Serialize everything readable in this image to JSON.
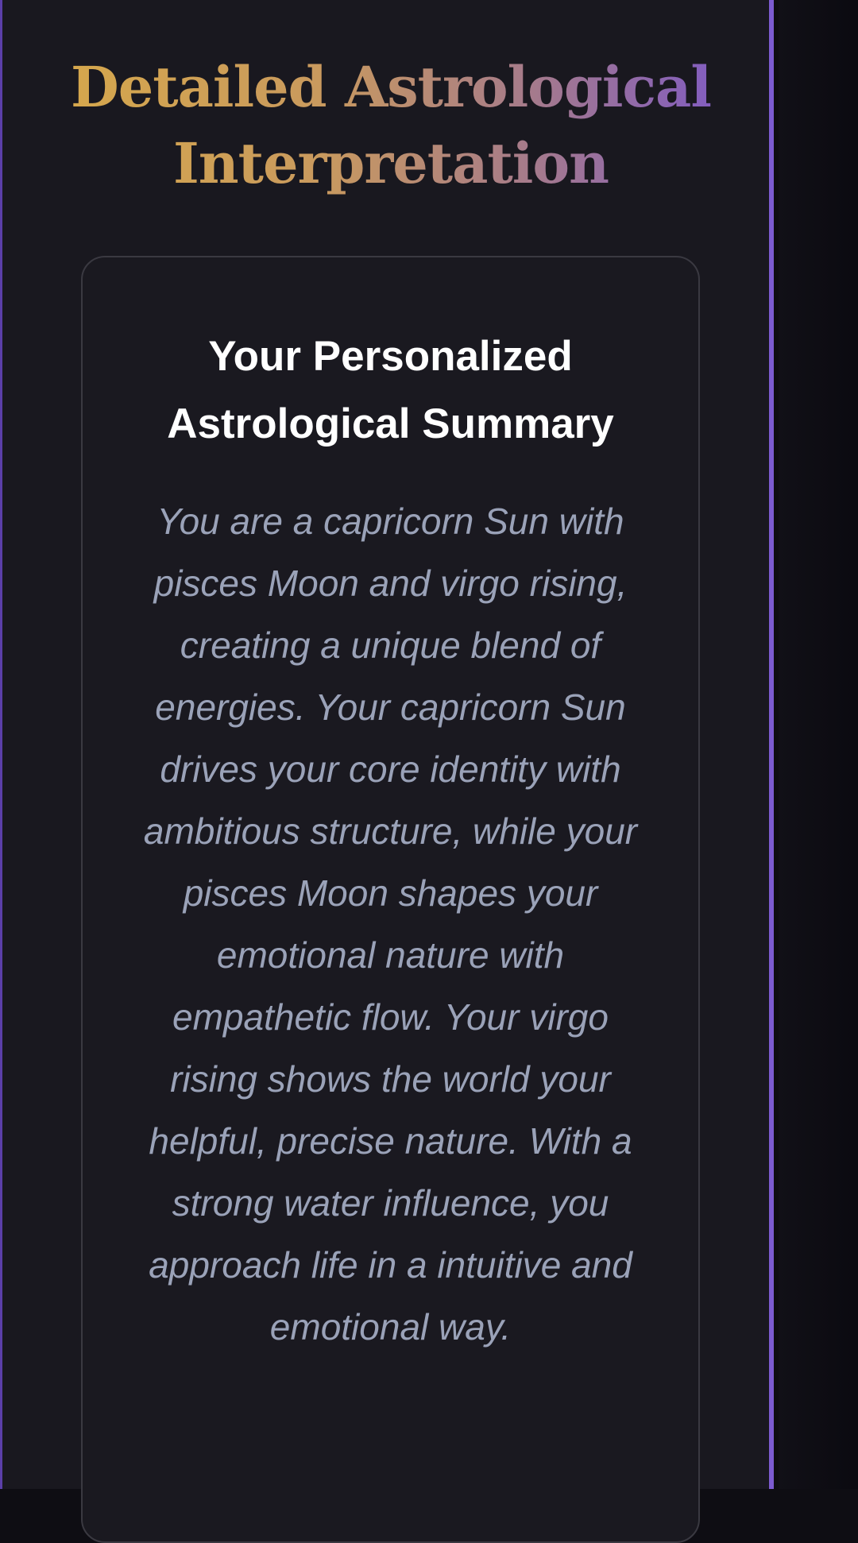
{
  "header": {
    "title": "Detailed Astrological Interpretation"
  },
  "summary_card": {
    "title": "Your Personalized Astrological Summary",
    "body": "You are a capricorn Sun with pisces Moon and virgo rising, creating a unique blend of energies. Your capricorn Sun drives your core identity with ambitious structure, while your pisces Moon shapes your emotional nature with empathetic flow. Your virgo rising shows the world your helpful, precise nature. With a strong water influence, you approach life in a intuitive and emotional way."
  },
  "colors": {
    "title_gradient_start": "#d7a94a",
    "title_gradient_end": "#7c58c8",
    "panel_border_accent": "#7c5bd0",
    "body_text": "#9aa2b8"
  }
}
